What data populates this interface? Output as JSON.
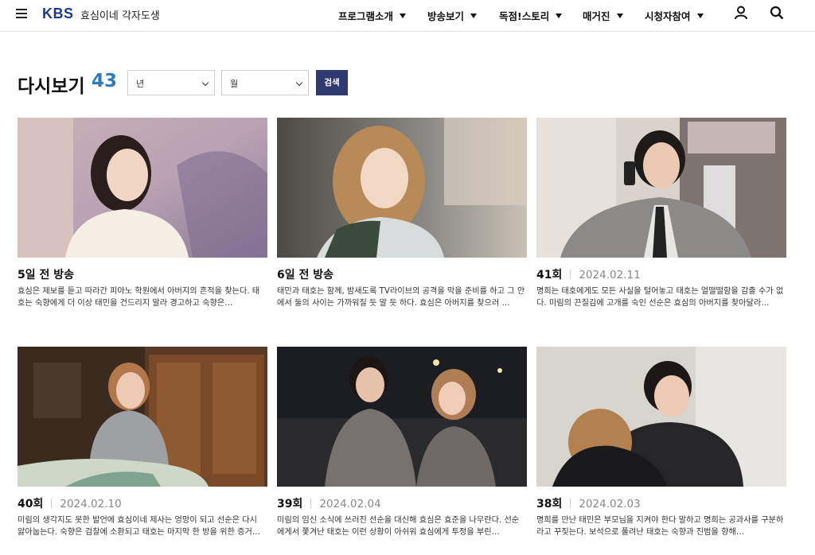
{
  "header": {
    "logo": "KBS",
    "show_title": "효심이네 각자도생",
    "nav": [
      {
        "label": "프로그램소개"
      },
      {
        "label": "방송보기"
      },
      {
        "label": "독점!스토리"
      },
      {
        "label": "매거진"
      },
      {
        "label": "시청자참여"
      }
    ],
    "icons": [
      "menu-icon",
      "user-icon",
      "search-icon"
    ]
  },
  "page": {
    "title": "다시보기",
    "count": "43",
    "filters": {
      "year_select": "년",
      "month_select": "월",
      "search_button": "검색"
    }
  },
  "episodes": [
    {
      "title": "5일 전 방송",
      "date": "",
      "desc": "효심은 제보를 듣고 따라간 피아노 학원에서 아버지의 흔적을 찾는다. 태호는 숙향에게 더 이상 태민을 건드리지 말라 경고하고 숙향은…"
    },
    {
      "title": "6일 전 방송",
      "date": "",
      "desc": "태민과 태호는 함께, 밤새도록 TV라이브의 공격을 막을 준비를 하고 그 안에서 둘의 사이는 가까워질 듯 말 듯 하다. 효심은 아버지를 찾으러 …"
    },
    {
      "title": "41회",
      "date": "2024.02.11",
      "desc": "명희는 태호에게도 모든 사실을 털어놓고 태호는 얼떨떨함을 감출 수가 없다. 미림의 끈질김에 고개를 숙인 선순은 효심의 아버지를 찾아달라…"
    },
    {
      "title": "40회",
      "date": "2024.02.10",
      "desc": "미림의 생각지도 못한 발언에 효심이네 제사는 엉망이 되고 선순은 다시 앓아눕는다. 숙향은 검찰에 소환되고 태호는 마지막 한 방을 위한 증거…"
    },
    {
      "title": "39회",
      "date": "2024.02.04",
      "desc": "미림의 임신 소식에 쓰러진 선순을 대신해 효심은 효준을 나무란다. 선순에게서 쫓겨난 태호는 이런 상황이 아쉬워 효심에게 투정을 부린…"
    },
    {
      "title": "38회",
      "date": "2024.02.03",
      "desc": "명희를 만난 태민은 부모님을 지켜야 한다 말하고 명희는 공과사를 구분하라고 꾸짖는다. 보석으로 풀려난 태호는 숙향과 진범을 향해…"
    }
  ],
  "colors": {
    "brand": "#1a3a8a",
    "count": "#2b7bbd",
    "search_button": "#2e3a6e"
  }
}
